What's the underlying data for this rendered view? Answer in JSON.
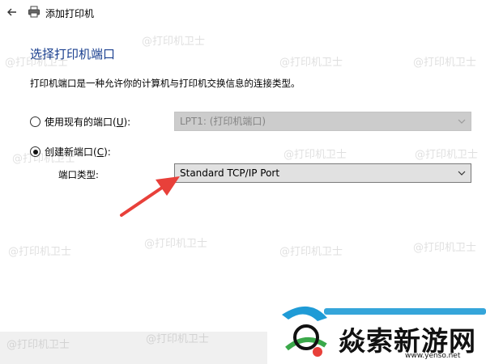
{
  "window": {
    "title": "添加打印机"
  },
  "heading": "选择打印机端口",
  "description": "打印机端口是一种允许你的计算机与打印机交换信息的连接类型。",
  "existing_port": {
    "label": "使用现有的端口(",
    "accel": "U",
    "label_end": "):",
    "selected": false,
    "value": "LPT1: (打印机端口)"
  },
  "new_port": {
    "label": "创建新端口(",
    "accel": "C",
    "label_end": "):",
    "selected": true,
    "type_label": "端口类型:",
    "type_value": "Standard TCP/IP Port"
  },
  "watermark_text": "@打印机卫士",
  "logo": {
    "text": "焱索新游网",
    "url": "www.yenso.net"
  },
  "colors": {
    "heading": "#1a3f8f",
    "disabled_select": "#cccccc",
    "active_select": "#e1e1e1",
    "arrow": "#e8403a"
  }
}
